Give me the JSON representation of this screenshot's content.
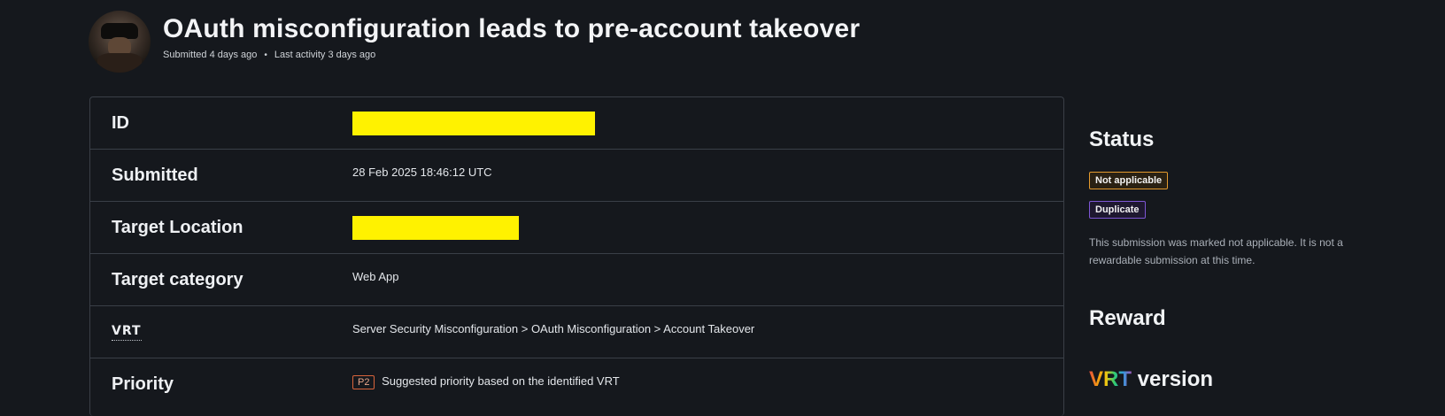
{
  "header": {
    "title": "OAuth misconfiguration leads to pre-account takeover",
    "submitted": "Submitted 4 days ago",
    "last_activity": "Last activity 3 days ago",
    "separator": "•"
  },
  "details": {
    "id_label": "ID",
    "submitted_label": "Submitted",
    "submitted_value": "28 Feb 2025 18:46:12 UTC",
    "target_location_label": "Target Location",
    "target_category_label": "Target category",
    "target_category_value": "Web App",
    "vrt_label": "VRT",
    "vrt_value": "Server Security Misconfiguration > OAuth Misconfiguration > Account Takeover",
    "priority_label": "Priority",
    "priority_badge": "P2",
    "priority_value": "Suggested priority based on the identified VRT"
  },
  "sidebar": {
    "status_heading": "Status",
    "status_badges": [
      "Not applicable",
      "Duplicate"
    ],
    "status_note": "This submission was marked not applicable. It is not a rewardable submission at this time.",
    "reward_heading": "Reward",
    "vrt_logo": "VRT",
    "vrt_version_heading": "version"
  },
  "colors": {
    "background": "#15181d",
    "redaction": "#fff200",
    "not_applicable_border": "#e39a2e",
    "duplicate_border": "#7d56d4",
    "priority_border": "#d9643b"
  }
}
